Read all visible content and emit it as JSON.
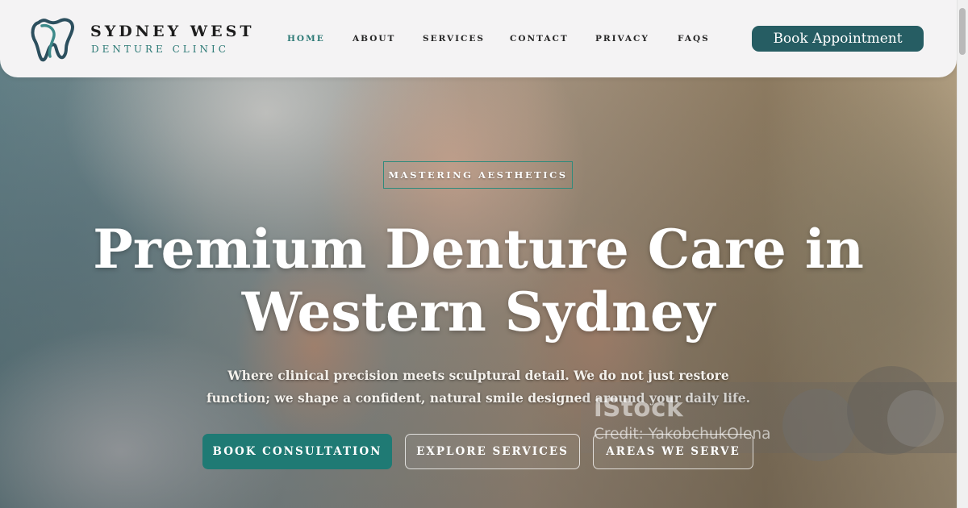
{
  "header": {
    "brand_name": "SYDNEY WEST",
    "brand_sub": "DENTURE CLINIC",
    "logo_icon": "tooth-logo-icon",
    "nav": [
      {
        "label": "HOME",
        "active": true
      },
      {
        "label": "ABOUT",
        "active": false
      },
      {
        "label": "SERVICES",
        "active": false
      },
      {
        "label": "CONTACT",
        "active": false
      },
      {
        "label": "PRIVACY",
        "active": false
      },
      {
        "label": "FAQS",
        "active": false
      }
    ],
    "cta_label": "Book Appointment"
  },
  "hero": {
    "badge": "MASTERING AESTHETICS",
    "headline_line1": "Premium Denture Care in",
    "headline_line2": "Western Sydney",
    "subtext": "Where clinical precision meets sculptural detail. We do not just restore function; we shape a confident, natural smile designed around your daily life.",
    "buttons": {
      "primary": "BOOK CONSULTATION",
      "explore": "EXPLORE SERVICES",
      "areas": "AREAS WE SERVE"
    }
  },
  "watermark": {
    "logo": "iStock",
    "credit": "Credit: YakobchukOlena"
  },
  "colors": {
    "accent": "#265d63",
    "teal": "#2d7a76",
    "primary_button": "#1f7a74",
    "header_bg": "#f4f3f4"
  }
}
